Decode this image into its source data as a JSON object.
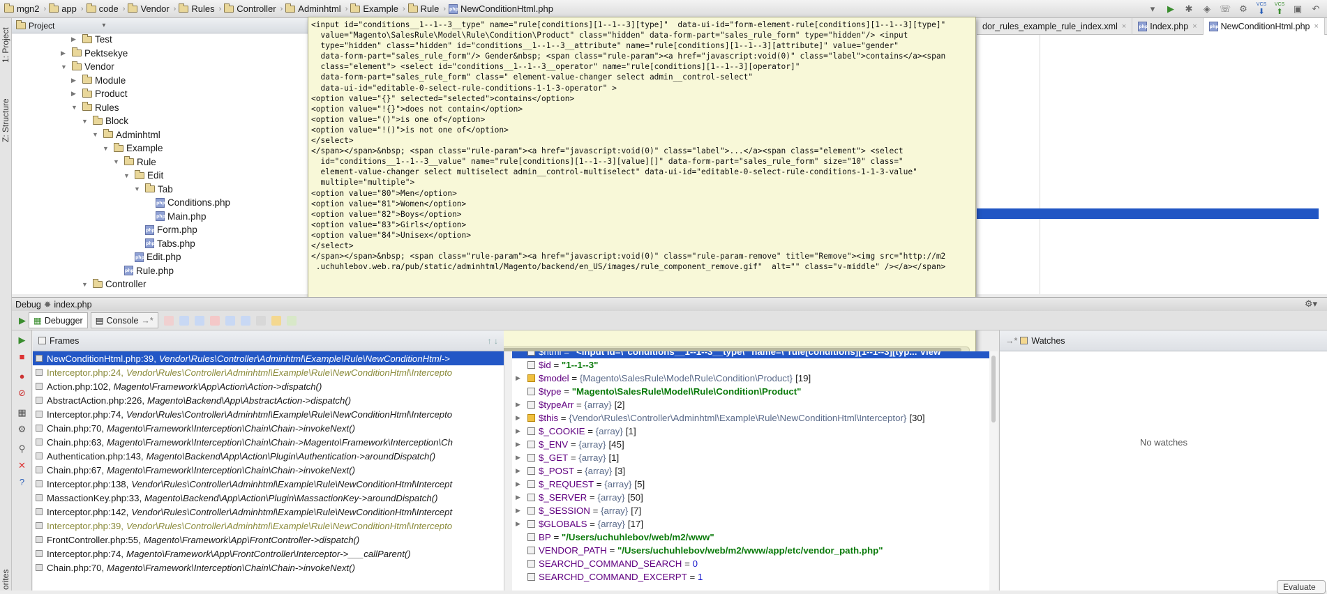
{
  "breadcrumb": [
    "mgn2",
    "app",
    "code",
    "Vendor",
    "Rules",
    "Controller",
    "Adminhtml",
    "Example",
    "Rule",
    "NewConditionHtml.php"
  ],
  "toolbar": {
    "vcs1": "VCS",
    "vcs2": "VCS"
  },
  "project": {
    "title": "Project",
    "tree": [
      {
        "label": "Test",
        "indent": 1,
        "type": "folder",
        "arrow": "right"
      },
      {
        "label": "Pektsekye",
        "indent": 0,
        "type": "folder",
        "arrow": "right"
      },
      {
        "label": "Vendor",
        "indent": 0,
        "type": "folder",
        "arrow": "down"
      },
      {
        "label": "Module",
        "indent": 1,
        "type": "folder",
        "arrow": "right"
      },
      {
        "label": "Product",
        "indent": 1,
        "type": "folder",
        "arrow": "right"
      },
      {
        "label": "Rules",
        "indent": 1,
        "type": "folder",
        "arrow": "down"
      },
      {
        "label": "Block",
        "indent": 2,
        "type": "folder",
        "arrow": "down"
      },
      {
        "label": "Adminhtml",
        "indent": 3,
        "type": "folder",
        "arrow": "down"
      },
      {
        "label": "Example",
        "indent": 4,
        "type": "folder",
        "arrow": "down"
      },
      {
        "label": "Rule",
        "indent": 5,
        "type": "folder",
        "arrow": "down"
      },
      {
        "label": "Edit",
        "indent": 6,
        "type": "folder",
        "arrow": "down"
      },
      {
        "label": "Tab",
        "indent": 7,
        "type": "folder",
        "arrow": "down"
      },
      {
        "label": "Conditions.php",
        "indent": 8,
        "type": "php",
        "arrow": ""
      },
      {
        "label": "Main.php",
        "indent": 8,
        "type": "php",
        "arrow": ""
      },
      {
        "label": "Form.php",
        "indent": 7,
        "type": "php",
        "arrow": ""
      },
      {
        "label": "Tabs.php",
        "indent": 7,
        "type": "php",
        "arrow": ""
      },
      {
        "label": "Edit.php",
        "indent": 6,
        "type": "php",
        "arrow": ""
      },
      {
        "label": "Rule.php",
        "indent": 5,
        "type": "php",
        "arrow": ""
      },
      {
        "label": "Controller",
        "indent": 2,
        "type": "folder",
        "arrow": "down"
      }
    ]
  },
  "editor_tabs": [
    {
      "label": "dor_rules_example_rule_index.xml",
      "active": false
    },
    {
      "label": "Index.php",
      "active": false
    },
    {
      "label": "NewConditionHtml.php",
      "active": true
    }
  ],
  "tooltip_text": "<input id=\"conditions__1--1--3__type\" name=\"rule[conditions][1--1--3][type]\"  data-ui-id=\"form-element-rule[conditions][1--1--3][type]\"\n  value=\"Magento\\SalesRule\\Model\\Rule\\Condition\\Product\" class=\"hidden\" data-form-part=\"sales_rule_form\" type=\"hidden\"/> <input\n  type=\"hidden\" class=\"hidden\" id=\"conditions__1--1--3__attribute\" name=\"rule[conditions][1--1--3][attribute]\" value=\"gender\"\n  data-form-part=\"sales_rule_form\"/> Gender&nbsp; <span class=\"rule-param\"><a href=\"javascript:void(0)\" class=\"label\">contains</a><span\n  class=\"element\"> <select id=\"conditions__1--1--3__operator\" name=\"rule[conditions][1--1--3][operator]\"\n  data-form-part=\"sales_rule_form\" class=\" element-value-changer select admin__control-select\"\n  data-ui-id=\"editable-0-select-rule-conditions-1-1-3-operator\" >\n<option value=\"{}\" selected=\"selected\">contains</option>\n<option value=\"!{}\">does not contain</option>\n<option value=\"()\">is one of</option>\n<option value=\"!()\">is not one of</option>\n</select>\n</span></span>&nbsp; <span class=\"rule-param\"><a href=\"javascript:void(0)\" class=\"label\">...</a><span class=\"element\"> <select\n  id=\"conditions__1--1--3__value\" name=\"rule[conditions][1--1--3][value][]\" data-form-part=\"sales_rule_form\" size=\"10\" class=\"\n  element-value-changer select multiselect admin__control-multiselect\" data-ui-id=\"editable-0-select-rule-conditions-1-1-3-value\"\n  multiple=\"multiple\">\n<option value=\"80\">Men</option>\n<option value=\"81\">Women</option>\n<option value=\"82\">Boys</option>\n<option value=\"83\">Girls</option>\n<option value=\"84\">Unisex</option>\n</select>\n</span></span>&nbsp; <span class=\"rule-param\"><a href=\"javascript:void(0)\" class=\"rule-param-remove\" title=\"Remove\"><img src=\"http://m2\n .uchuhlebov.web.ra/pub/static/adminhtml/Magento/backend/en_US/images/rule_component_remove.gif\"  alt=\"\" class=\"v-middle\" /></a></span>",
  "debug": {
    "title": "Debug",
    "config": "index.php",
    "tabs": [
      "Debugger",
      "Console"
    ],
    "frames_title": "Frames",
    "watches_title": "Watches",
    "no_watches": "No watches",
    "evaluate": "Evaluate"
  },
  "frames": [
    {
      "file": "NewConditionHtml.php:39,",
      "ns": "Vendor\\Rules\\Controller\\Adminhtml\\Example\\Rule\\NewConditionHtml->",
      "style": "sel"
    },
    {
      "file": "Interceptor.php:24,",
      "ns": "Vendor\\Rules\\Controller\\Adminhtml\\Example\\Rule\\NewConditionHtml\\Intercepto",
      "style": "lib"
    },
    {
      "file": "Action.php:102,",
      "ns": "Magento\\Framework\\App\\Action\\Action->dispatch()",
      "style": ""
    },
    {
      "file": "AbstractAction.php:226,",
      "ns": "Magento\\Backend\\App\\AbstractAction->dispatch()",
      "style": ""
    },
    {
      "file": "Interceptor.php:74,",
      "ns": "Vendor\\Rules\\Controller\\Adminhtml\\Example\\Rule\\NewConditionHtml\\Intercepto",
      "style": ""
    },
    {
      "file": "Chain.php:70,",
      "ns": "Magento\\Framework\\Interception\\Chain\\Chain->invokeNext()",
      "style": ""
    },
    {
      "file": "Chain.php:63,",
      "ns": "Magento\\Framework\\Interception\\Chain\\Chain->Magento\\Framework\\Interception\\Ch",
      "style": ""
    },
    {
      "file": "Authentication.php:143,",
      "ns": "Magento\\Backend\\App\\Action\\Plugin\\Authentication->aroundDispatch()",
      "style": ""
    },
    {
      "file": "Chain.php:67,",
      "ns": "Magento\\Framework\\Interception\\Chain\\Chain->invokeNext()",
      "style": ""
    },
    {
      "file": "Interceptor.php:138,",
      "ns": "Vendor\\Rules\\Controller\\Adminhtml\\Example\\Rule\\NewConditionHtml\\Intercept",
      "style": ""
    },
    {
      "file": "MassactionKey.php:33,",
      "ns": "Magento\\Backend\\App\\Action\\Plugin\\MassactionKey->aroundDispatch()",
      "style": ""
    },
    {
      "file": "Interceptor.php:142,",
      "ns": "Vendor\\Rules\\Controller\\Adminhtml\\Example\\Rule\\NewConditionHtml\\Intercept",
      "style": ""
    },
    {
      "file": "Interceptor.php:39,",
      "ns": "Vendor\\Rules\\Controller\\Adminhtml\\Example\\Rule\\NewConditionHtml\\Intercepto",
      "style": "lib"
    },
    {
      "file": "FrontController.php:55,",
      "ns": "Magento\\Framework\\App\\FrontController->dispatch()",
      "style": ""
    },
    {
      "file": "Interceptor.php:74,",
      "ns": "Magento\\Framework\\App\\FrontController\\Interceptor->___callParent()",
      "style": ""
    },
    {
      "file": "Chain.php:70,",
      "ns": "Magento\\Framework\\Interception\\Chain\\Chain->invokeNext()",
      "style": ""
    }
  ],
  "variables": [
    {
      "name": "$html",
      "eq": " = ",
      "value": "\"<input id=\\\"conditions__1--1--3__type\\\" name=\\\"rule[conditions][1--1--3][typ...",
      "extra": "View",
      "kind": "s",
      "exp": false,
      "sel": true
    },
    {
      "name": "$id",
      "eq": " = ",
      "value": "\"1--1--3\"",
      "extra": "",
      "kind": "s",
      "exp": false
    },
    {
      "name": "$model",
      "eq": " = ",
      "value": "{Magento\\SalesRule\\Model\\Rule\\Condition\\Product}",
      "extra": "[19]",
      "kind": "m",
      "exp": true,
      "obj": true
    },
    {
      "name": "$type",
      "eq": " = ",
      "value": "\"Magento\\SalesRule\\Model\\Rule\\Condition\\Product\"",
      "extra": "",
      "kind": "s",
      "exp": false
    },
    {
      "name": "$typeArr",
      "eq": " = ",
      "value": "{array}",
      "extra": "[2]",
      "kind": "m",
      "exp": true
    },
    {
      "name": "$this",
      "eq": " = ",
      "value": "{Vendor\\Rules\\Controller\\Adminhtml\\Example\\Rule\\NewConditionHtml\\Interceptor}",
      "extra": "[30]",
      "kind": "m",
      "exp": true,
      "obj": true
    },
    {
      "name": "$_COOKIE",
      "eq": " = ",
      "value": "{array}",
      "extra": "[1]",
      "kind": "m",
      "exp": true
    },
    {
      "name": "$_ENV",
      "eq": " = ",
      "value": "{array}",
      "extra": "[45]",
      "kind": "m",
      "exp": true
    },
    {
      "name": "$_GET",
      "eq": " = ",
      "value": "{array}",
      "extra": "[1]",
      "kind": "m",
      "exp": true
    },
    {
      "name": "$_POST",
      "eq": " = ",
      "value": "{array}",
      "extra": "[3]",
      "kind": "m",
      "exp": true
    },
    {
      "name": "$_REQUEST",
      "eq": " = ",
      "value": "{array}",
      "extra": "[5]",
      "kind": "m",
      "exp": true
    },
    {
      "name": "$_SERVER",
      "eq": " = ",
      "value": "{array}",
      "extra": "[50]",
      "kind": "m",
      "exp": true
    },
    {
      "name": "$_SESSION",
      "eq": " = ",
      "value": "{array}",
      "extra": "[7]",
      "kind": "m",
      "exp": true
    },
    {
      "name": "$GLOBALS",
      "eq": " = ",
      "value": "{array}",
      "extra": "[17]",
      "kind": "m",
      "exp": true
    },
    {
      "name": "BP",
      "eq": " = ",
      "value": "\"/Users/uchuhlebov/web/m2/www\"",
      "extra": "",
      "kind": "s",
      "exp": false
    },
    {
      "name": "VENDOR_PATH",
      "eq": " = ",
      "value": "\"/Users/uchuhlebov/web/m2/www/app/etc/vendor_path.php\"",
      "extra": "",
      "kind": "s",
      "exp": false
    },
    {
      "name": "SEARCHD_COMMAND_SEARCH",
      "eq": " = ",
      "value": "0",
      "extra": "",
      "kind": "b",
      "exp": false
    },
    {
      "name": "SEARCHD_COMMAND_EXCERPT",
      "eq": " = ",
      "value": "1",
      "extra": "",
      "kind": "b",
      "exp": false
    }
  ],
  "side_labels": {
    "project": "1: Project",
    "structure": "Z: Structure",
    "favorites": "orites"
  },
  "colors": {
    "selection": "#2357c6",
    "tooltip_bg": "#f8f8d8",
    "string_green": "#0b7a0b"
  }
}
